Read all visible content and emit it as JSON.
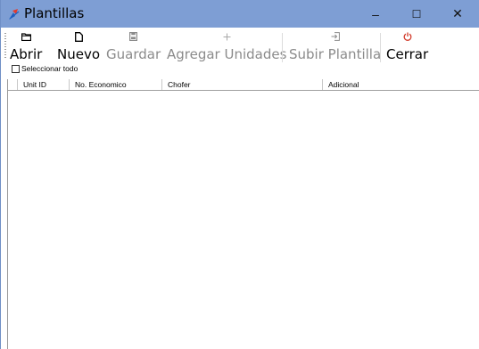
{
  "window": {
    "title": "Plantillas",
    "controls": {
      "minimize": "–",
      "maximize": "☐",
      "close": "✕"
    }
  },
  "toolbar": {
    "open_label": "Abrir",
    "new_label": "Nuevo",
    "save_label": "Guardar",
    "add_units_label": "Agregar Unidades",
    "upload_label": "Subir Plantilla",
    "close_label": "Cerrar",
    "select_all_label": "Seleccionar todo",
    "accent_close_color": "#d23b2b",
    "disabled_color": "#8b8b8b"
  },
  "grid": {
    "columns": [
      "Unit ID",
      "No. Economico",
      "Chofer",
      "Adicional"
    ],
    "rows": []
  }
}
